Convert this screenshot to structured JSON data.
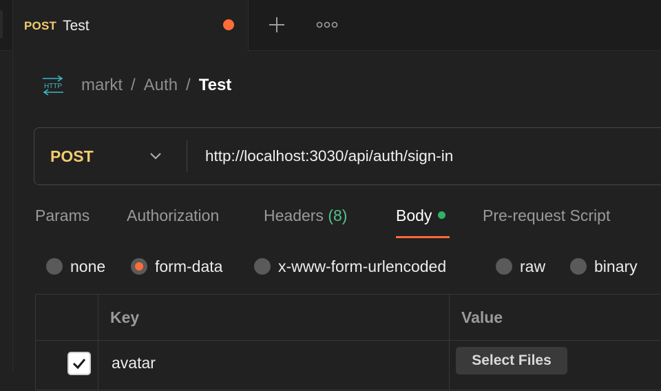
{
  "tab": {
    "method": "POST",
    "title": "Test",
    "unsaved_color": "#ff6c37"
  },
  "icons": {
    "new_tab": "plus-icon",
    "more": "more-horizontal-icon",
    "request_type": "http-icon",
    "method_dropdown": "chevron-down-icon",
    "checked": "checkmark-icon"
  },
  "breadcrumb": {
    "icon_text": "HTTP",
    "items": [
      "markt",
      "Auth"
    ],
    "separator": "/",
    "current": "Test"
  },
  "request": {
    "method": "POST",
    "url": "http://localhost:3030/api/auth/sign-in"
  },
  "request_tabs": {
    "params": "Params",
    "authorization": "Authorization",
    "headers": "Headers",
    "headers_count": "(8)",
    "body": "Body",
    "pre_request": "Pre-request Script",
    "active": "Body"
  },
  "body_types": {
    "none": "none",
    "form_data": "form-data",
    "urlencoded": "x-www-form-urlencoded",
    "raw": "raw",
    "binary": "binary",
    "selected": "form-data"
  },
  "form_table": {
    "headers": {
      "key": "Key",
      "value": "Value"
    },
    "rows": [
      {
        "enabled": true,
        "key": "avatar",
        "value_button": "Select Files"
      }
    ]
  },
  "colors": {
    "accent": "#ff6c37",
    "method": "#f2cc6e",
    "body_indicator": "#2fb26a",
    "headers_count": "#55c08a"
  }
}
